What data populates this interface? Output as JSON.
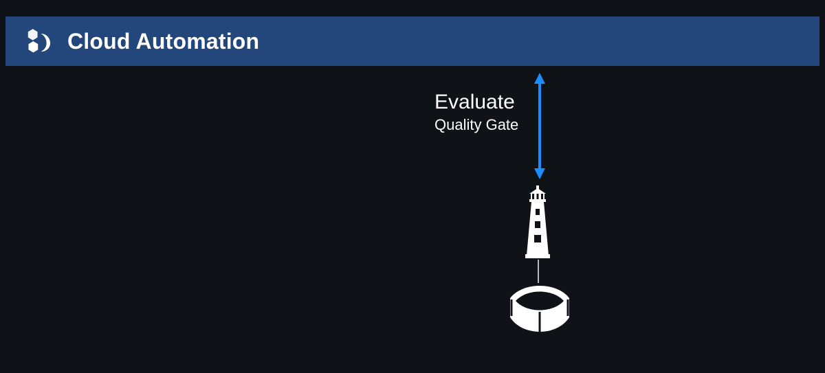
{
  "header": {
    "title": "Cloud Automation"
  },
  "arrow": {
    "color": "#1c8cff"
  },
  "label": {
    "line1": "Evaluate",
    "line2": "Quality Gate"
  },
  "icons": {
    "logo": "dynatrace-logo-icon",
    "lighthouse": "lighthouse-icon",
    "cube": "cube-icon"
  }
}
